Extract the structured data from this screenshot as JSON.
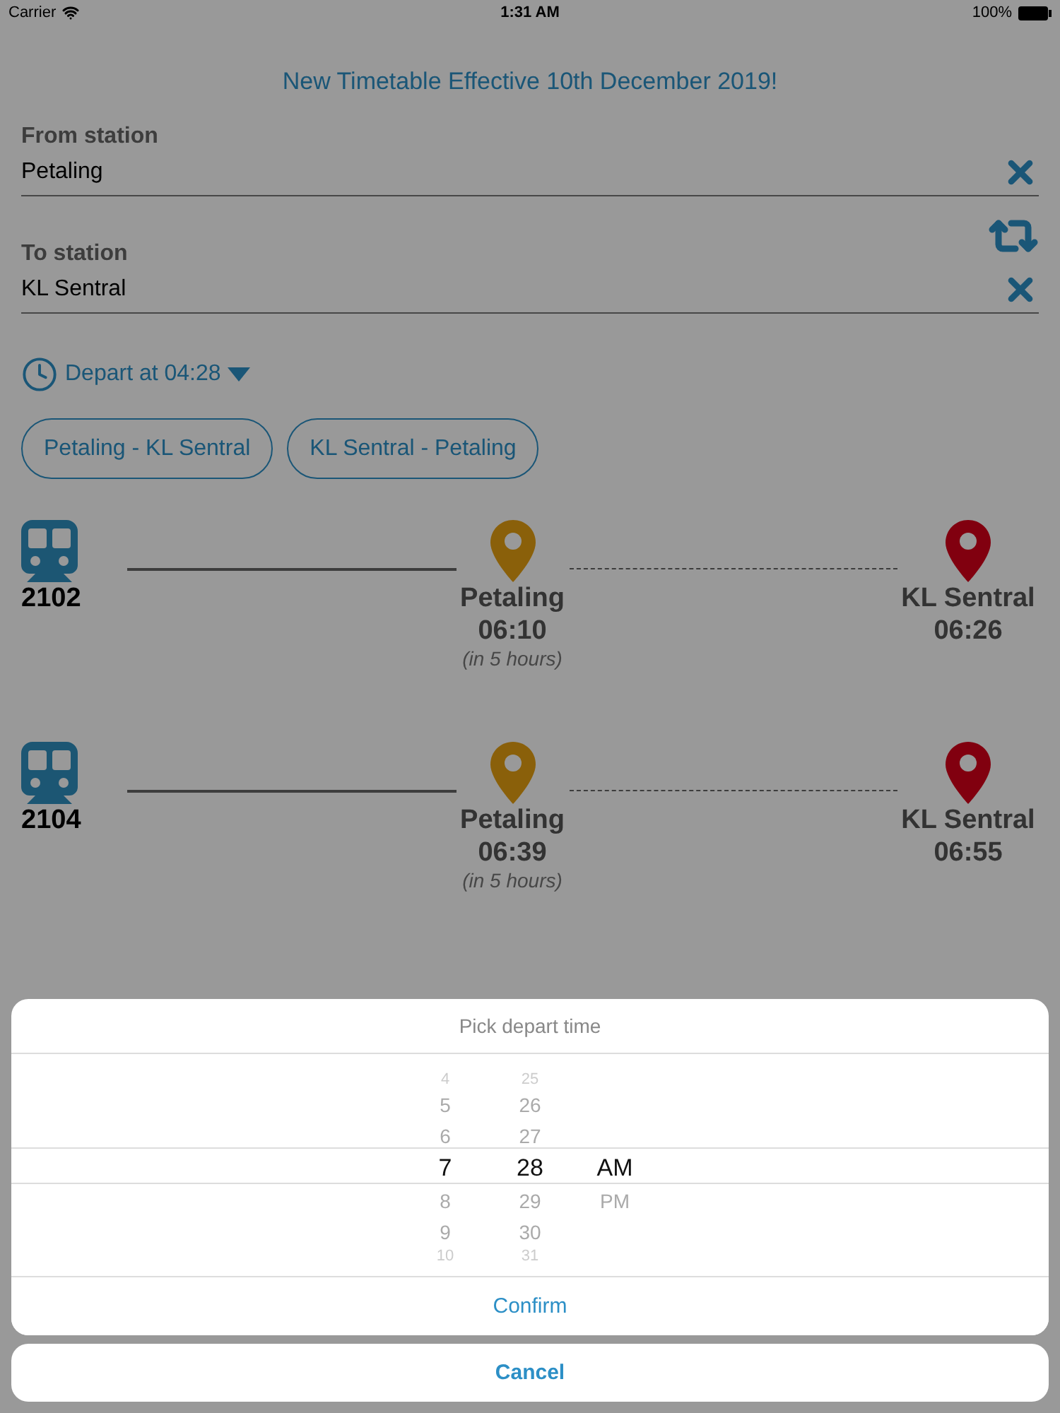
{
  "status_bar": {
    "carrier": "Carrier",
    "time": "1:31 AM",
    "battery": "100%"
  },
  "notice": "New Timetable Effective 10th December 2019!",
  "from": {
    "label": "From station",
    "value": "Petaling"
  },
  "to": {
    "label": "To station",
    "value": "KL Sentral"
  },
  "depart": {
    "label": "Depart at 04:28"
  },
  "routes": [
    {
      "label": "Petaling - KL Sentral"
    },
    {
      "label": "KL Sentral - Petaling"
    }
  ],
  "trips": [
    {
      "train": "2102",
      "origin": "Petaling",
      "origin_time": "06:10",
      "relative": "(in 5 hours)",
      "destination": "KL Sentral",
      "destination_time": "06:26"
    },
    {
      "train": "2104",
      "origin": "Petaling",
      "origin_time": "06:39",
      "relative": "(in 5 hours)",
      "destination": "KL Sentral",
      "destination_time": "06:55"
    }
  ],
  "sheet": {
    "title": "Pick depart time",
    "columns": [
      {
        "items": [
          {
            "label": "4",
            "selected": false
          },
          {
            "label": "5",
            "selected": false
          },
          {
            "label": "6",
            "selected": false
          },
          {
            "label": "7",
            "selected": true
          },
          {
            "label": "8",
            "selected": false
          },
          {
            "label": "9",
            "selected": false
          },
          {
            "label": "10",
            "selected": false
          }
        ]
      },
      {
        "items": [
          {
            "label": "25",
            "selected": false
          },
          {
            "label": "26",
            "selected": false
          },
          {
            "label": "27",
            "selected": false
          },
          {
            "label": "28",
            "selected": true
          },
          {
            "label": "29",
            "selected": false
          },
          {
            "label": "30",
            "selected": false
          },
          {
            "label": "31",
            "selected": false
          }
        ]
      },
      {
        "items": [
          {
            "label": "AM",
            "selected": true
          },
          {
            "label": "PM",
            "selected": false
          }
        ]
      }
    ],
    "confirm": "Confirm",
    "cancel": "Cancel"
  }
}
